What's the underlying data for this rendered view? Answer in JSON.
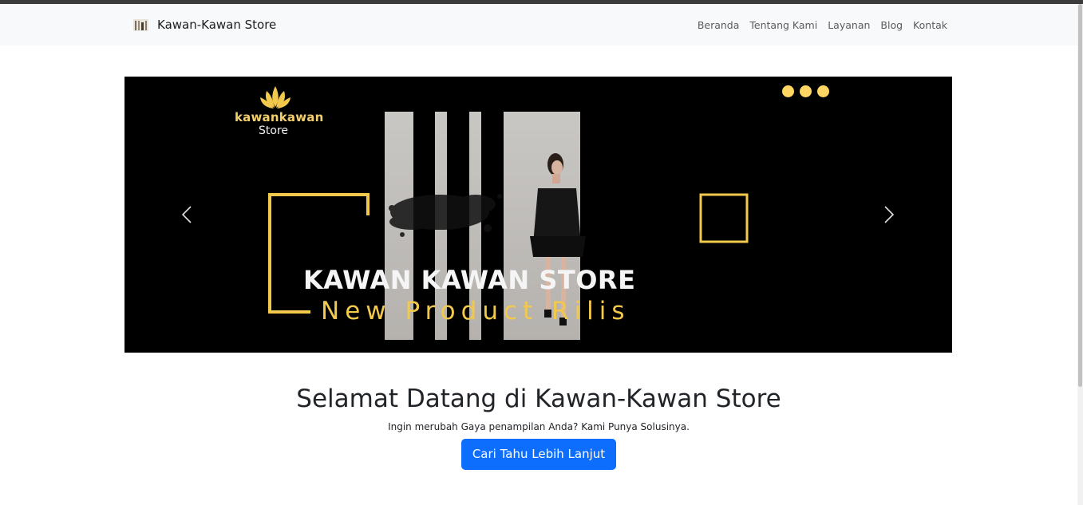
{
  "navbar": {
    "brand": "Kawan-Kawan Store",
    "links": [
      "Beranda",
      "Tentang Kami",
      "Layanan",
      "Blog",
      "Kontak"
    ]
  },
  "carousel": {
    "logo_word": "kawankawan",
    "logo_sub": "Store",
    "title": "KAWAN KAWAN STORE",
    "subtitle": "New Product Rilis",
    "indicator_count": 3,
    "prev_icon": "chevron-left-icon",
    "next_icon": "chevron-right-icon"
  },
  "hero": {
    "title": "Selamat Datang di Kawan-Kawan Store",
    "lead": "Ingin merubah Gaya penampilan Anda? Kami Punya Solusinya.",
    "button": "Cari Tahu Lebih Lanjut"
  },
  "colors": {
    "primary": "#0d6efd",
    "accent_gold": "#f2c94c",
    "navbar_bg": "#f8f9fa",
    "carousel_bg": "#000000"
  }
}
